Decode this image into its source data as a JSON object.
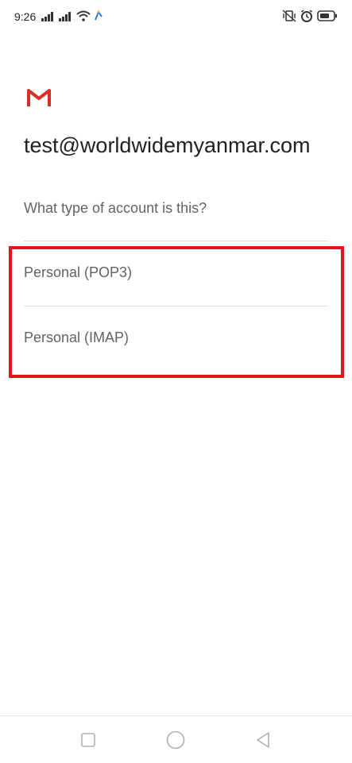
{
  "status_bar": {
    "time": "9:26",
    "left_icons": [
      "signal-icon",
      "signal-icon",
      "wifi-icon",
      "sync-icon"
    ],
    "right_icons": [
      "vibrate-icon",
      "alarm-icon",
      "battery-icon"
    ]
  },
  "app": {
    "logo": "gmail-logo-icon",
    "brand_color": "#d93025"
  },
  "header": {
    "email": "test@worldwidemyanmar.com",
    "question": "What type of account is this?"
  },
  "options": [
    {
      "label": "Personal (POP3)"
    },
    {
      "label": "Personal (IMAP)"
    }
  ],
  "highlight": {
    "color": "#e3141b"
  },
  "nav_bar": {
    "buttons": [
      "recent-apps-icon",
      "home-icon",
      "back-icon"
    ]
  }
}
